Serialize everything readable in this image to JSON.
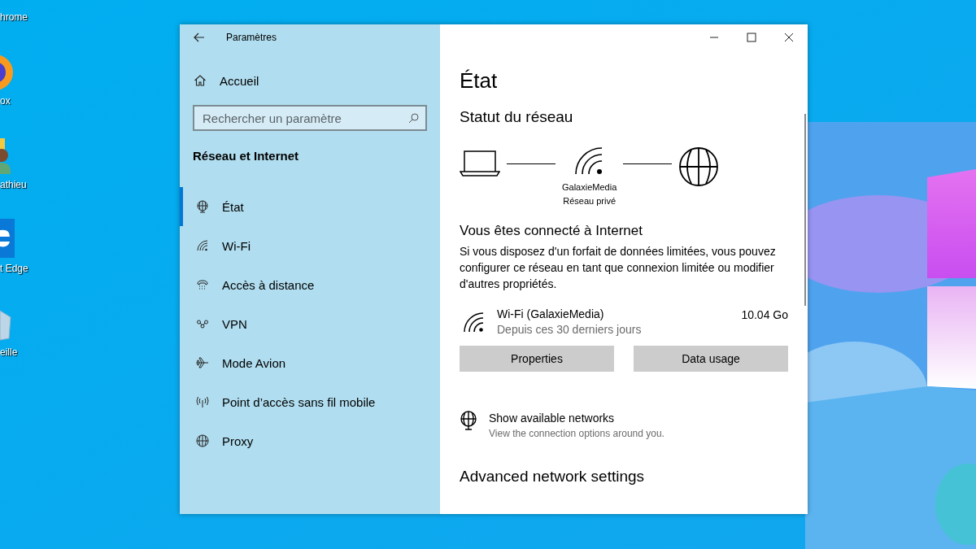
{
  "desktop_icons": [
    {
      "kind": "none",
      "label": "hrome"
    },
    {
      "kind": "ball",
      "label": "ox"
    },
    {
      "kind": "person",
      "label": "athieu"
    },
    {
      "kind": "tile",
      "label": "t Edge"
    },
    {
      "kind": "bin",
      "label": "eille"
    }
  ],
  "window": {
    "title": "Paramètres"
  },
  "sidebar": {
    "home": "Accueil",
    "search": {
      "placeholder": "Rechercher un paramètre"
    },
    "section": "Réseau et Internet",
    "items": [
      {
        "kind": "status",
        "label": "État",
        "selected": true
      },
      {
        "kind": "wifi",
        "label": "Wi-Fi",
        "selected": false
      },
      {
        "kind": "dialup",
        "label": "Accès à distance",
        "selected": false
      },
      {
        "kind": "vpn",
        "label": "VPN",
        "selected": false
      },
      {
        "kind": "airplane",
        "label": "Mode Avion",
        "selected": false
      },
      {
        "kind": "hotspot",
        "label": "Point d’accès sans fil mobile",
        "selected": false
      },
      {
        "kind": "proxy",
        "label": "Proxy",
        "selected": false
      }
    ]
  },
  "content": {
    "title": "État",
    "section": "Statut du réseau",
    "diagram": {
      "network_name": "GalaxieMedia",
      "network_type": "Réseau privé"
    },
    "connected_heading": "Vous êtes connecté à Internet",
    "connected_text": "Si vous disposez d'un forfait de données limitées, vous pouvez configurer ce réseau en tant que connexion limitée ou modifier d'autres propriétés.",
    "usage": {
      "name": "Wi-Fi (GalaxieMedia)",
      "period": "Depuis ces 30 derniers jours",
      "amount": "10.04 Go"
    },
    "buttons": [
      "Properties",
      "Data usage"
    ],
    "networks_link": {
      "title": "Show available networks",
      "subtitle": "View the connection options around you."
    },
    "advanced_heading": "Advanced network settings"
  }
}
